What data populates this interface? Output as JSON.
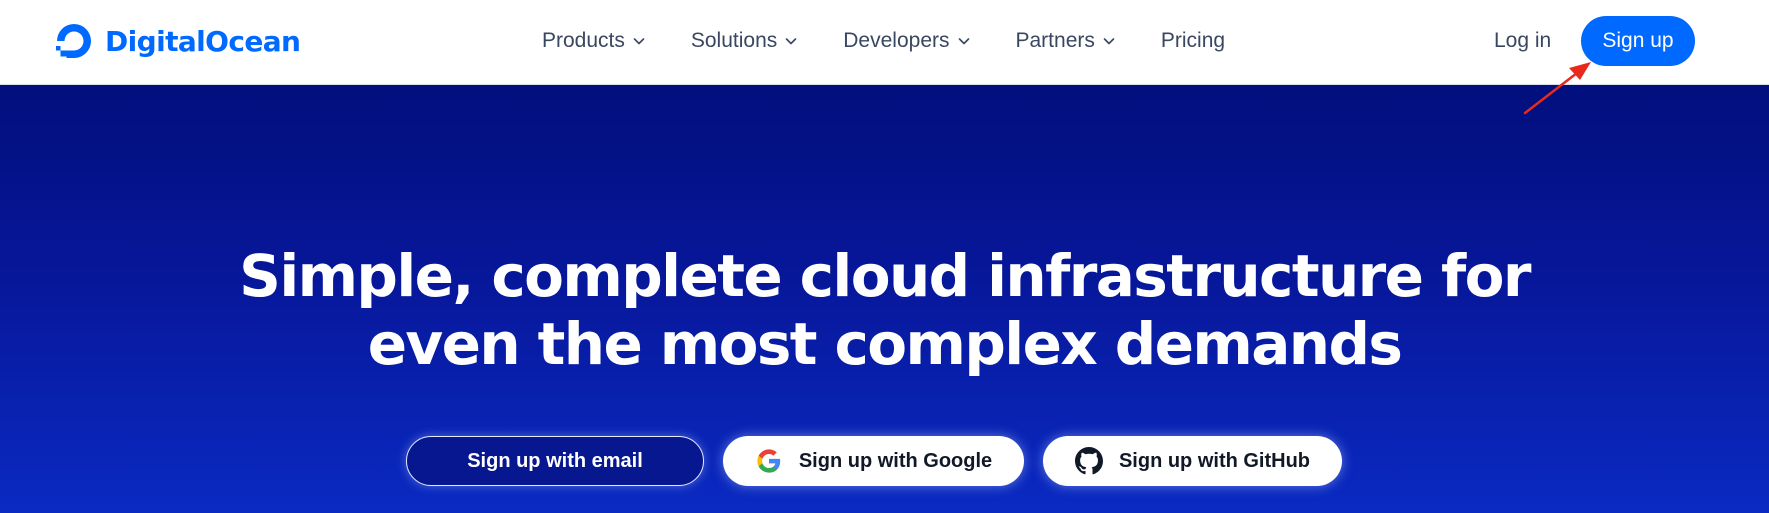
{
  "header": {
    "logo": {
      "text": "DigitalOcean",
      "icon": "digitalocean-logo-icon",
      "color": "#0069ff"
    },
    "nav": [
      {
        "label": "Products",
        "has_dropdown": true
      },
      {
        "label": "Solutions",
        "has_dropdown": true
      },
      {
        "label": "Developers",
        "has_dropdown": true
      },
      {
        "label": "Partners",
        "has_dropdown": true
      },
      {
        "label": "Pricing",
        "has_dropdown": false
      }
    ],
    "login_label": "Log in",
    "signup_label": "Sign up",
    "accent_color": "#0069ff"
  },
  "hero": {
    "title_line1": "Simple, complete cloud infrastructure for",
    "title_line2": "even the most complex demands",
    "background_color": "#061b9a",
    "cta": {
      "email_label": "Sign up with email",
      "google_label": "Sign up with Google",
      "google_icon": "google-icon",
      "github_label": "Sign up with GitHub",
      "github_icon": "github-icon"
    }
  },
  "annotation": {
    "arrow_color": "#e8291c",
    "target": "signup-button"
  }
}
